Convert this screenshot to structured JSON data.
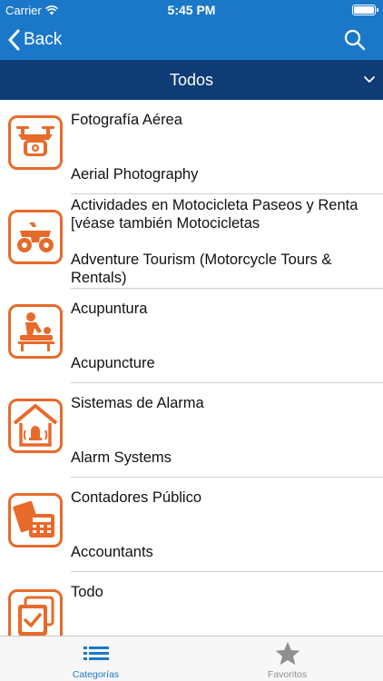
{
  "status": {
    "carrier": "Carrier",
    "time": "5:45 PM"
  },
  "nav": {
    "back_label": "Back"
  },
  "filter": {
    "label": "Todos"
  },
  "categories": [
    {
      "name_es": "Fotografía Aérea",
      "name_en": "Aerial Photography",
      "icon": "drone-camera-icon"
    },
    {
      "name_es": "Actividades en Motocicleta Paseos y Renta [véase también  Motocicletas",
      "name_en": "Adventure Tourism (Motorcycle Tours & Rentals)",
      "icon": "atv-quad-icon"
    },
    {
      "name_es": "Acupuntura",
      "name_en": "Acupuncture",
      "icon": "acupuncture-massage-icon"
    },
    {
      "name_es": "Sistemas de Alarma",
      "name_en": "Alarm Systems",
      "icon": "house-alarm-icon"
    },
    {
      "name_es": "Contadores Público",
      "name_en": "Accountants",
      "icon": "calculator-icon"
    },
    {
      "name_es": "Todo",
      "name_en": "",
      "icon": "checklist-icon"
    }
  ],
  "tabs": [
    {
      "label": "Categorías",
      "icon": "list-icon",
      "active": true
    },
    {
      "label": "Favoritos",
      "icon": "star-icon",
      "active": false
    }
  ],
  "colors": {
    "nav_blue": "#1b78c8",
    "filter_navy": "#0f3c75",
    "icon_orange": "#e86a2a",
    "tab_active": "#1b78c8",
    "tab_inactive": "#8e8e93"
  }
}
